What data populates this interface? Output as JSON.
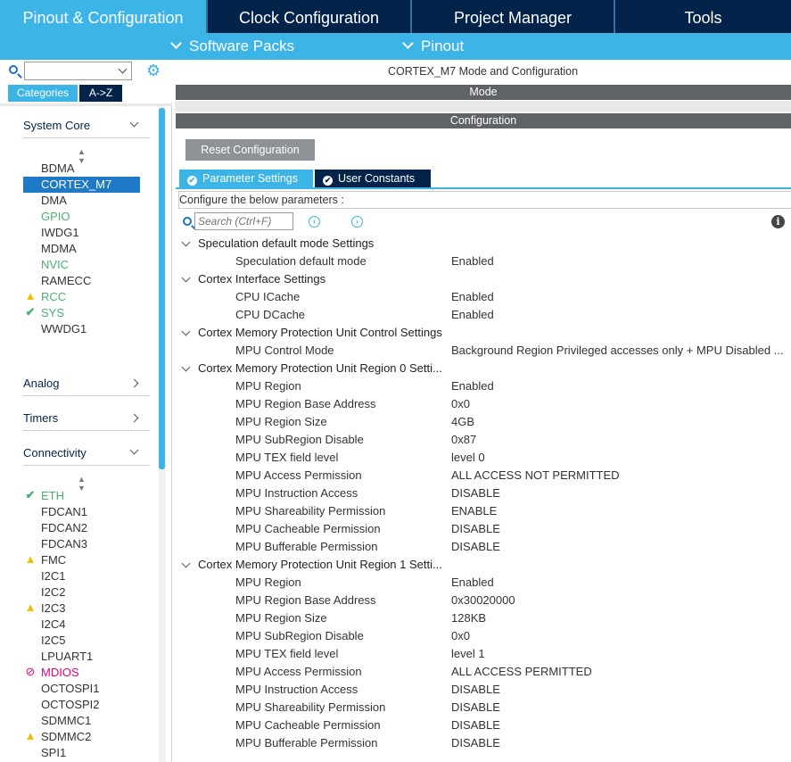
{
  "top_tabs": [
    "Pinout & Configuration",
    "Clock Configuration",
    "Project Manager",
    "Tools"
  ],
  "sub_menu": [
    "Software Packs",
    "Pinout"
  ],
  "left": {
    "search_value": "",
    "view_toggle": [
      "Categories",
      "A->Z"
    ],
    "sections": [
      "System Core",
      "Analog",
      "Timers",
      "Connectivity"
    ],
    "system_core_items": [
      {
        "label": "BDMA",
        "status": "none"
      },
      {
        "label": "CORTEX_M7",
        "status": "selected"
      },
      {
        "label": "DMA",
        "status": "none"
      },
      {
        "label": "GPIO",
        "status": "configured"
      },
      {
        "label": "IWDG1",
        "status": "none"
      },
      {
        "label": "MDMA",
        "status": "none"
      },
      {
        "label": "NVIC",
        "status": "configured"
      },
      {
        "label": "RAMECC",
        "status": "none"
      },
      {
        "label": "RCC",
        "status": "warning"
      },
      {
        "label": "SYS",
        "status": "ok"
      },
      {
        "label": "WWDG1",
        "status": "none"
      }
    ],
    "connectivity_items": [
      {
        "label": "ETH",
        "status": "ok"
      },
      {
        "label": "FDCAN1",
        "status": "none"
      },
      {
        "label": "FDCAN2",
        "status": "none"
      },
      {
        "label": "FDCAN3",
        "status": "none"
      },
      {
        "label": "FMC",
        "status": "warning"
      },
      {
        "label": "I2C1",
        "status": "none"
      },
      {
        "label": "I2C2",
        "status": "none"
      },
      {
        "label": "I2C3",
        "status": "warning"
      },
      {
        "label": "I2C4",
        "status": "none"
      },
      {
        "label": "I2C5",
        "status": "none"
      },
      {
        "label": "LPUART1",
        "status": "none"
      },
      {
        "label": "MDIOS",
        "status": "disabled"
      },
      {
        "label": "OCTOSPI1",
        "status": "none"
      },
      {
        "label": "OCTOSPI2",
        "status": "none"
      },
      {
        "label": "SDMMC1",
        "status": "none"
      },
      {
        "label": "SDMMC2",
        "status": "warning"
      },
      {
        "label": "SPI1",
        "status": "none"
      }
    ]
  },
  "right": {
    "title": "CORTEX_M7 Mode and Configuration",
    "mode_bar": "Mode",
    "config_bar": "Configuration",
    "reset_button": "Reset Configuration",
    "param_tabs": [
      "Parameter Settings",
      "User Constants"
    ],
    "configure_label": "Configure the below parameters :",
    "search_placeholder": "Search (Ctrl+F)",
    "rows": [
      {
        "type": "group",
        "label": "Speculation default mode Settings"
      },
      {
        "type": "param",
        "name": "Speculation default mode",
        "value": "Enabled"
      },
      {
        "type": "group",
        "label": "Cortex Interface Settings"
      },
      {
        "type": "param",
        "name": "CPU ICache",
        "value": "Enabled"
      },
      {
        "type": "param",
        "name": "CPU DCache",
        "value": "Enabled"
      },
      {
        "type": "group",
        "label": "Cortex Memory Protection Unit Control Settings"
      },
      {
        "type": "param",
        "name": "MPU Control Mode",
        "value": "Background Region Privileged accesses only + MPU Disabled ..."
      },
      {
        "type": "group",
        "label": "Cortex Memory Protection Unit Region 0 Setti..."
      },
      {
        "type": "param",
        "name": "MPU Region",
        "value": "Enabled"
      },
      {
        "type": "param",
        "name": "MPU Region Base Address",
        "value": "0x0"
      },
      {
        "type": "param",
        "name": "MPU Region Size",
        "value": "4GB"
      },
      {
        "type": "param",
        "name": "MPU SubRegion Disable",
        "value": "0x87"
      },
      {
        "type": "param",
        "name": "MPU TEX field level",
        "value": "level 0"
      },
      {
        "type": "param",
        "name": "MPU Access Permission",
        "value": "ALL ACCESS NOT PERMITTED"
      },
      {
        "type": "param",
        "name": "MPU Instruction Access",
        "value": "DISABLE"
      },
      {
        "type": "param",
        "name": "MPU Shareability Permission",
        "value": "ENABLE"
      },
      {
        "type": "param",
        "name": "MPU Cacheable Permission",
        "value": "DISABLE"
      },
      {
        "type": "param",
        "name": "MPU Bufferable  Permission",
        "value": "DISABLE"
      },
      {
        "type": "group",
        "label": "Cortex Memory Protection Unit Region 1 Setti..."
      },
      {
        "type": "param",
        "name": "MPU Region",
        "value": "Enabled"
      },
      {
        "type": "param",
        "name": "MPU Region Base Address",
        "value": "0x30020000"
      },
      {
        "type": "param",
        "name": "MPU Region Size",
        "value": "128KB"
      },
      {
        "type": "param",
        "name": "MPU SubRegion Disable",
        "value": "0x0"
      },
      {
        "type": "param",
        "name": "MPU TEX field level",
        "value": "level 1"
      },
      {
        "type": "param",
        "name": "MPU Access Permission",
        "value": "ALL ACCESS PERMITTED"
      },
      {
        "type": "param",
        "name": "MPU Instruction Access",
        "value": "DISABLE"
      },
      {
        "type": "param",
        "name": "MPU Shareability Permission",
        "value": "DISABLE"
      },
      {
        "type": "param",
        "name": "MPU Cacheable Permission",
        "value": "DISABLE"
      },
      {
        "type": "param",
        "name": "MPU Bufferable  Permission",
        "value": "DISABLE"
      }
    ]
  },
  "colors": {
    "accent": "#3cb4e6",
    "dark_navy": "#03234b",
    "selected": "#1e7ac6",
    "ok_green": "#49b170",
    "warning_yellow": "#f0c000",
    "disabled_magenta": "#e6007e"
  }
}
